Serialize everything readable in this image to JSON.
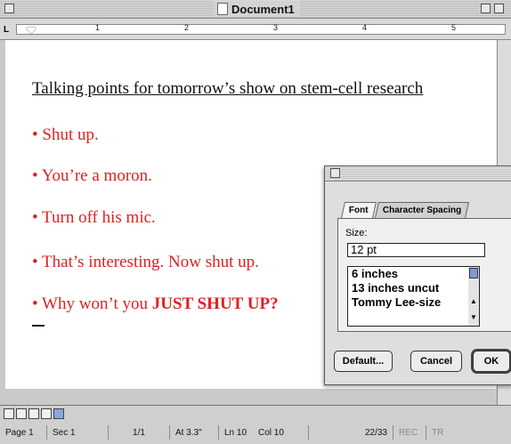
{
  "window": {
    "title": "Document1"
  },
  "ruler": {
    "numbers": [
      "1",
      "2",
      "3",
      "4",
      "5"
    ]
  },
  "document": {
    "heading": "Talking points for tomorrow’s show on stem-cell research",
    "bullets": [
      "• Shut up.",
      "• You’re a moron.",
      "• Turn off his mic.",
      "• That’s interesting. Now shut up.",
      {
        "prefix": "• Why won’t you ",
        "emphasis": "JUST SHUT UP?"
      }
    ]
  },
  "status": {
    "page": "Page 1",
    "sec": "Sec 1",
    "pages": "1/1",
    "at": "At 3.3\"",
    "ln": "Ln 10",
    "col": "Col 10",
    "count": "22/33",
    "rec": "REC",
    "trk": "TR"
  },
  "font_dialog": {
    "tabs": [
      "Font",
      "Character Spacing"
    ],
    "size_label": "Size:",
    "size_value": "12 pt",
    "size_options": [
      "6 inches",
      "13 inches uncut",
      "Tommy Lee-size"
    ],
    "buttons": {
      "default": "Default...",
      "cancel": "Cancel",
      "ok": "OK"
    }
  },
  "colors": {
    "bullet_text": "#e02020",
    "heading_text": "#111111"
  }
}
